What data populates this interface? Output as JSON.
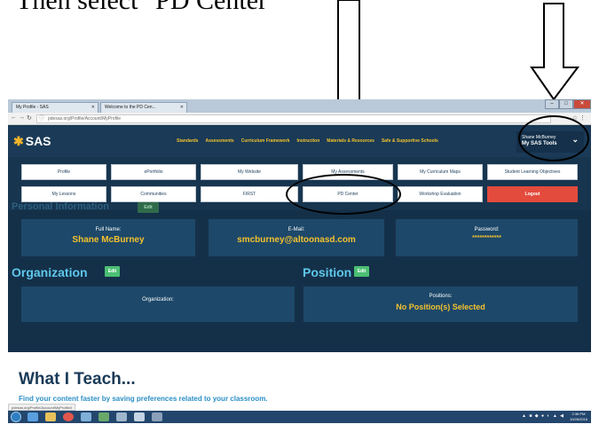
{
  "instruction": "Then select \"PD Center\"",
  "browser": {
    "tabs": [
      {
        "label": "My Profile - SAS"
      },
      {
        "label": "Welcome to the PD Cen..."
      }
    ],
    "url": "pdesas.org/Profile/Account/MyProfile",
    "status_url": "pdesas.org/Profile/Account/MyProfile#"
  },
  "site": {
    "logo": "SAS",
    "nav": [
      "Standards",
      "Assessments",
      "Curriculum Framework",
      "Instruction",
      "Materials & Resources",
      "Safe & Supportive Schools"
    ],
    "user": {
      "name": "Shane McBurney",
      "tools": "My SAS Tools"
    }
  },
  "tools_menu": {
    "row1": [
      "Profile",
      "ePortfolio",
      "My Website",
      "My Assessments",
      "My Curriculum Maps",
      "Student Learning Objectives"
    ],
    "row2": [
      "My Lessons",
      "Communities",
      "FIRST",
      "PD Center",
      "Workshop Evaluation",
      "Logout"
    ]
  },
  "personal": {
    "title": "Personal Information",
    "edit": "Edit",
    "full_name_label": "Full Name:",
    "full_name": "Shane McBurney",
    "email_label": "E-Mail:",
    "email": "smcburney@altoonasd.com",
    "password_label": "Password:",
    "password": "************"
  },
  "organization": {
    "title": "Organization",
    "edit": "Edit",
    "label": "Organization:"
  },
  "position": {
    "title": "Position",
    "edit": "Edit",
    "label": "Positions:",
    "value": "No Position(s) Selected"
  },
  "teach": {
    "title": "What I Teach...",
    "subtitle": "Find your content faster by saving preferences related to your classroom."
  },
  "taskbar": {
    "time": "2:36 PM",
    "date": "10/26/2016"
  }
}
